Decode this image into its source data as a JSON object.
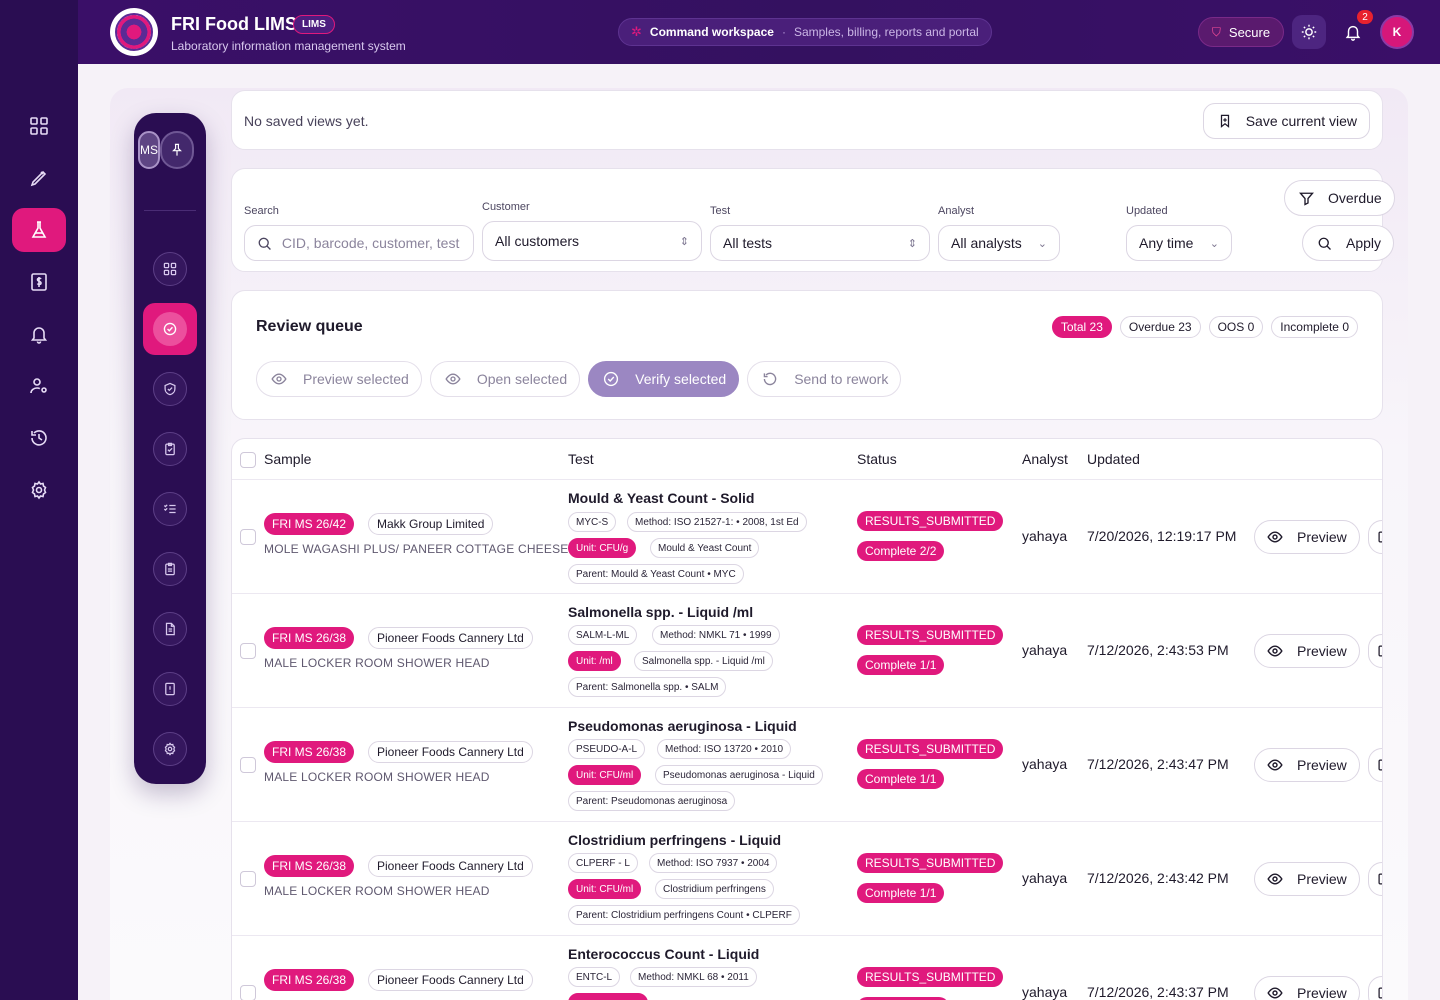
{
  "header": {
    "app_title": "FRI Food LIMS",
    "app_badge": "LIMS",
    "app_subtitle": "Laboratory information management system",
    "workspace_title": "Command workspace",
    "workspace_sep": "·",
    "workspace_subtitle": "Samples, billing, reports and portal",
    "secure_label": "Secure",
    "notification_count": "2",
    "avatar_initial": "K"
  },
  "rail": {
    "items": [
      "dashboard-icon",
      "pen-icon",
      "flask-icon",
      "billing-icon",
      "bell-icon",
      "user-settings-icon",
      "history-icon",
      "gear-icon"
    ],
    "active": "flask-icon"
  },
  "inner_sidebar": {
    "ms_label": "MS",
    "items": [
      "grid-icon",
      "check-circle-icon",
      "shield-check-icon",
      "clipboard-check-icon",
      "list-check-icon",
      "clipboard-icon",
      "document-icon",
      "report-alert-icon",
      "gear-icon"
    ],
    "active": "check-circle-icon"
  },
  "saved_views": {
    "empty_text": "No saved views yet.",
    "save_button": "Save current view"
  },
  "filters": {
    "search_label": "Search",
    "search_placeholder": "CID, barcode, customer, test",
    "customer_label": "Customer",
    "customer_value": "All customers",
    "test_label": "Test",
    "test_value": "All tests",
    "analyst_label": "Analyst",
    "analyst_value": "All analysts",
    "updated_label": "Updated",
    "updated_value": "Any time",
    "overdue_button": "Overdue",
    "apply_button": "Apply"
  },
  "queue": {
    "title": "Review queue",
    "chips": [
      "Total 23",
      "Overdue 23",
      "OOS 0",
      "Incomplete 0"
    ],
    "actions": {
      "preview": "Preview selected",
      "open": "Open selected",
      "verify": "Verify selected",
      "rework": "Send to rework"
    }
  },
  "table": {
    "columns": {
      "sample": "Sample",
      "test": "Test",
      "status": "Status",
      "analyst": "Analyst",
      "updated": "Updated"
    },
    "preview_label": "Preview",
    "rows": [
      {
        "sample_id": "FRI MS 26/42",
        "customer": "Makk Group Limited",
        "description": "MOLE WAGASHI PLUS/ PANEER COTTAGE CHEESE",
        "test_name": "Mould & Yeast Count - Solid",
        "code": "MYC-S",
        "method": "Method: ISO 21527-1: • 2008, 1st Ed",
        "unit": "Unit: CFU/g",
        "analyte": "Mould & Yeast Count",
        "parent": "Parent: Mould & Yeast Count • MYC",
        "status": "RESULTS_SUBMITTED",
        "completion": "Complete 2/2",
        "analyst": "yahaya",
        "updated": "7/20/2026, 12:19:17 PM"
      },
      {
        "sample_id": "FRI MS 26/38",
        "customer": "Pioneer Foods Cannery Ltd",
        "description": "MALE LOCKER ROOM SHOWER HEAD",
        "test_name": "Salmonella spp. - Liquid /ml",
        "code": "SALM-L-ML",
        "method": "Method: NMKL 71 • 1999",
        "unit": "Unit: /ml",
        "analyte": "Salmonella spp. - Liquid /ml",
        "parent": "Parent: Salmonella spp. • SALM",
        "status": "RESULTS_SUBMITTED",
        "completion": "Complete 1/1",
        "analyst": "yahaya",
        "updated": "7/12/2026, 2:43:53 PM"
      },
      {
        "sample_id": "FRI MS 26/38",
        "customer": "Pioneer Foods Cannery Ltd",
        "description": "MALE LOCKER ROOM SHOWER HEAD",
        "test_name": "Pseudomonas aeruginosa - Liquid",
        "code": "PSEUDO-A-L",
        "method": "Method: ISO 13720 • 2010",
        "unit": "Unit: CFU/ml",
        "analyte": "Pseudomonas aeruginosa - Liquid",
        "parent": "Parent: Pseudomonas aeruginosa",
        "status": "RESULTS_SUBMITTED",
        "completion": "Complete 1/1",
        "analyst": "yahaya",
        "updated": "7/12/2026, 2:43:47 PM"
      },
      {
        "sample_id": "FRI MS 26/38",
        "customer": "Pioneer Foods Cannery Ltd",
        "description": "MALE LOCKER ROOM SHOWER HEAD",
        "test_name": "Clostridium perfringens - Liquid",
        "code": "CLPERF - L",
        "method": "Method: ISO 7937 • 2004",
        "unit": "Unit: CFU/ml",
        "analyte": "Clostridium perfringens",
        "parent": "Parent: Clostridium perfringens Count • CLPERF",
        "status": "RESULTS_SUBMITTED",
        "completion": "Complete 1/1",
        "analyst": "yahaya",
        "updated": "7/12/2026, 2:43:42 PM"
      },
      {
        "sample_id": "FRI MS 26/38",
        "customer": "Pioneer Foods Cannery Ltd",
        "description": "",
        "test_name": "Enterococcus Count - Liquid",
        "code": "ENTC-L",
        "method": "Method: NMKL 68 • 2011",
        "unit": "",
        "analyte": "",
        "parent": "",
        "status": "RESULTS_SUBMITTED",
        "completion": "",
        "analyst": "yahaya",
        "updated": "7/12/2026, 2:43:37 PM"
      }
    ]
  },
  "colors": {
    "accent": "#e0197d",
    "rail": "#2a0d52",
    "header": "#3a0f68",
    "verify": "#9b87c2"
  }
}
